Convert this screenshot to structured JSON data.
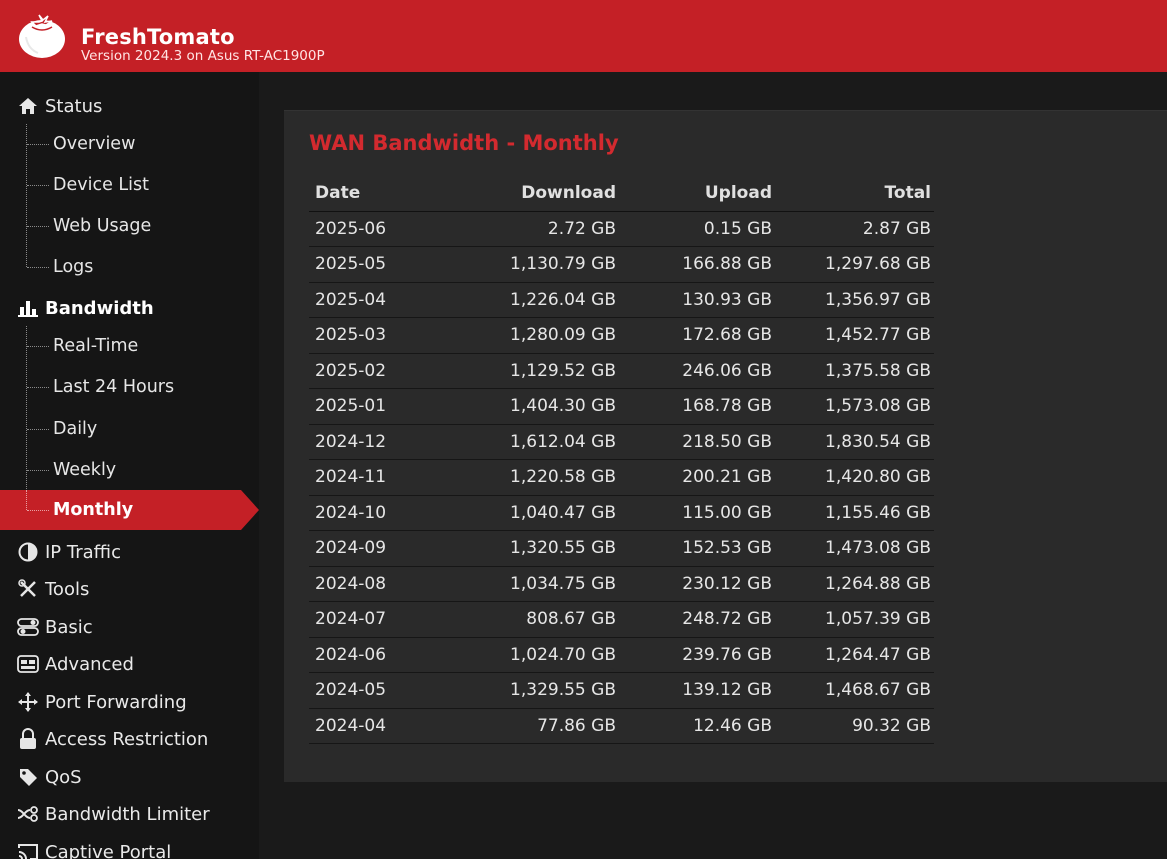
{
  "header": {
    "title": "FreshTomato",
    "version": "Version 2024.3 on Asus RT-AC1900P"
  },
  "sidebar": {
    "status": {
      "label": "Status",
      "items": [
        "Overview",
        "Device List",
        "Web Usage",
        "Logs"
      ]
    },
    "bandwidth": {
      "label": "Bandwidth",
      "items": [
        "Real-Time",
        "Last 24 Hours",
        "Daily",
        "Weekly",
        "Monthly"
      ],
      "active": "Monthly"
    },
    "groups": [
      {
        "label": "IP Traffic",
        "icon": "pie-chart-icon"
      },
      {
        "label": "Tools",
        "icon": "tools-icon"
      },
      {
        "label": "Basic",
        "icon": "toggle-icon"
      },
      {
        "label": "Advanced",
        "icon": "advanced-icon"
      },
      {
        "label": "Port Forwarding",
        "icon": "port-forward-icon"
      },
      {
        "label": "Access Restriction",
        "icon": "lock-icon"
      },
      {
        "label": "QoS",
        "icon": "tag-icon"
      },
      {
        "label": "Bandwidth Limiter",
        "icon": "limiter-icon"
      },
      {
        "label": "Captive Portal",
        "icon": "cast-icon"
      }
    ]
  },
  "main": {
    "title": "WAN Bandwidth - Monthly",
    "columns": [
      "Date",
      "Download",
      "Upload",
      "Total"
    ],
    "rows": [
      [
        "2025-06",
        "2.72 GB",
        "0.15 GB",
        "2.87 GB"
      ],
      [
        "2025-05",
        "1,130.79 GB",
        "166.88 GB",
        "1,297.68 GB"
      ],
      [
        "2025-04",
        "1,226.04 GB",
        "130.93 GB",
        "1,356.97 GB"
      ],
      [
        "2025-03",
        "1,280.09 GB",
        "172.68 GB",
        "1,452.77 GB"
      ],
      [
        "2025-02",
        "1,129.52 GB",
        "246.06 GB",
        "1,375.58 GB"
      ],
      [
        "2025-01",
        "1,404.30 GB",
        "168.78 GB",
        "1,573.08 GB"
      ],
      [
        "2024-12",
        "1,612.04 GB",
        "218.50 GB",
        "1,830.54 GB"
      ],
      [
        "2024-11",
        "1,220.58 GB",
        "200.21 GB",
        "1,420.80 GB"
      ],
      [
        "2024-10",
        "1,040.47 GB",
        "115.00 GB",
        "1,155.46 GB"
      ],
      [
        "2024-09",
        "1,320.55 GB",
        "152.53 GB",
        "1,473.08 GB"
      ],
      [
        "2024-08",
        "1,034.75 GB",
        "230.12 GB",
        "1,264.88 GB"
      ],
      [
        "2024-07",
        "808.67 GB",
        "248.72 GB",
        "1,057.39 GB"
      ],
      [
        "2024-06",
        "1,024.70 GB",
        "239.76 GB",
        "1,264.47 GB"
      ],
      [
        "2024-05",
        "1,329.55 GB",
        "139.12 GB",
        "1,468.67 GB"
      ],
      [
        "2024-04",
        "77.86 GB",
        "12.46 GB",
        "90.32 GB"
      ]
    ]
  },
  "colors": {
    "accent": "#c42026",
    "title_red": "#d32a2f",
    "sidebar_bg": "#151515",
    "panel_bg": "#2a2a2a"
  }
}
